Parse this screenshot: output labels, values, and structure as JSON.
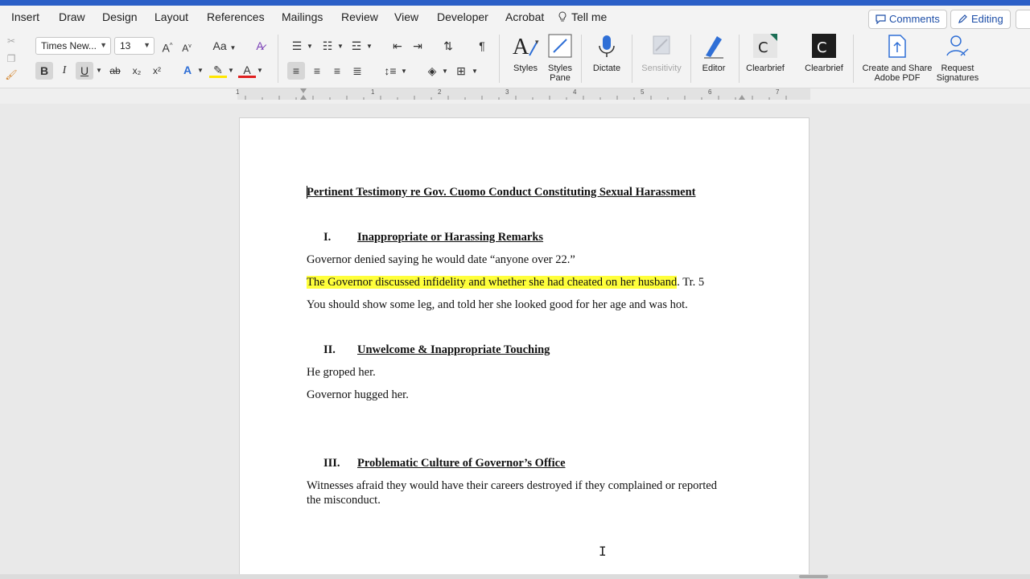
{
  "tabs": [
    "Insert",
    "Draw",
    "Design",
    "Layout",
    "References",
    "Mailings",
    "Review",
    "View",
    "Developer",
    "Acrobat"
  ],
  "tell_me": "Tell me",
  "header_buttons": {
    "comments": "Comments",
    "editing": "Editing"
  },
  "ribbon": {
    "font_name": "Times New...",
    "font_size": "13",
    "aa_label": "Aa",
    "bold": "B",
    "italic": "I",
    "underline": "U",
    "strike": "ab",
    "subscript": "x₂",
    "superscript": "x²",
    "styles": "Styles",
    "styles_pane": [
      "Styles",
      "Pane"
    ],
    "dictate": "Dictate",
    "sensitivity": "Sensitivity",
    "editor": "Editor",
    "clearbrief_1": "Clearbrief",
    "clearbrief_2": "Clearbrief",
    "create_share": [
      "Create and Share",
      "Adobe PDF"
    ],
    "request_sig": [
      "Request",
      "Signatures"
    ]
  },
  "ruler_numbers": [
    "1",
    "1",
    "2",
    "3",
    "4",
    "5",
    "6",
    "7"
  ],
  "document": {
    "title": "Pertinent Testimony re Gov. Cuomo Conduct Constituting Sexual Harassment",
    "section1": {
      "num": "I.",
      "heading": "Inappropriate or Harassing Remarks"
    },
    "p1": "Governor denied saying he would date “anyone over 22.”",
    "p2_highlight": "The Governor discussed infidelity and whether she had cheated on her husband",
    "p2_rest": ". Tr. 5",
    "p3": "You should show some leg, and told her she looked good for her age and was hot.",
    "section2": {
      "num": "II.",
      "heading": "Unwelcome & Inappropriate Touching"
    },
    "p4": "He groped her.",
    "p5": "Governor hugged her.",
    "section3": {
      "num": "III.",
      "heading": "Problematic Culture of Governor’s Office"
    },
    "p6_line1": "Witnesses afraid they would have their careers destroyed if they complained or reported",
    "p6_line2": "the misconduct."
  },
  "colors": {
    "title_bar": "#2b5fc7",
    "highlight": "#ffff3b",
    "accent": "#1e4fa8"
  }
}
